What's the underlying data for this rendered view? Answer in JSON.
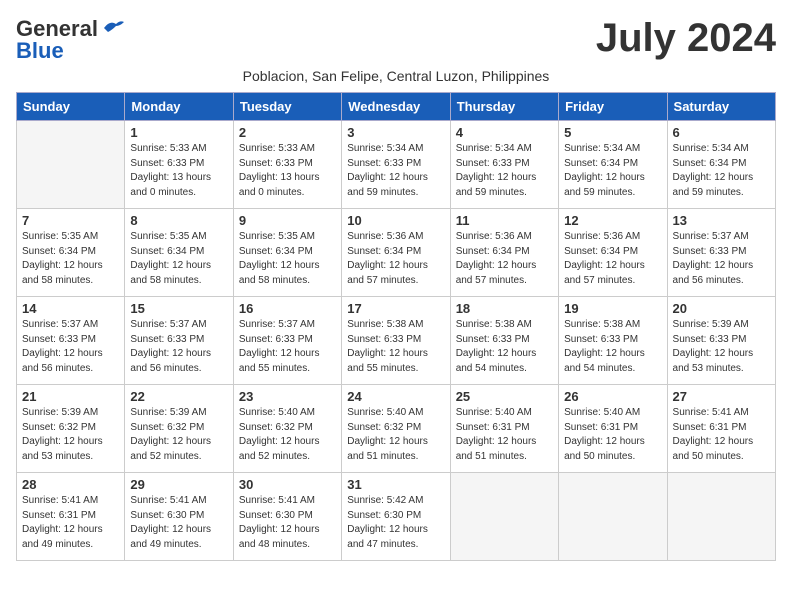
{
  "header": {
    "logo_line1": "General",
    "logo_line2": "Blue",
    "month": "July 2024",
    "subtitle": "Poblacion, San Felipe, Central Luzon, Philippines"
  },
  "days_of_week": [
    "Sunday",
    "Monday",
    "Tuesday",
    "Wednesday",
    "Thursday",
    "Friday",
    "Saturday"
  ],
  "weeks": [
    [
      {
        "date": "",
        "info": ""
      },
      {
        "date": "1",
        "info": "Sunrise: 5:33 AM\nSunset: 6:33 PM\nDaylight: 13 hours\nand 0 minutes."
      },
      {
        "date": "2",
        "info": "Sunrise: 5:33 AM\nSunset: 6:33 PM\nDaylight: 13 hours\nand 0 minutes."
      },
      {
        "date": "3",
        "info": "Sunrise: 5:34 AM\nSunset: 6:33 PM\nDaylight: 12 hours\nand 59 minutes."
      },
      {
        "date": "4",
        "info": "Sunrise: 5:34 AM\nSunset: 6:33 PM\nDaylight: 12 hours\nand 59 minutes."
      },
      {
        "date": "5",
        "info": "Sunrise: 5:34 AM\nSunset: 6:34 PM\nDaylight: 12 hours\nand 59 minutes."
      },
      {
        "date": "6",
        "info": "Sunrise: 5:34 AM\nSunset: 6:34 PM\nDaylight: 12 hours\nand 59 minutes."
      }
    ],
    [
      {
        "date": "7",
        "info": "Sunrise: 5:35 AM\nSunset: 6:34 PM\nDaylight: 12 hours\nand 58 minutes."
      },
      {
        "date": "8",
        "info": "Sunrise: 5:35 AM\nSunset: 6:34 PM\nDaylight: 12 hours\nand 58 minutes."
      },
      {
        "date": "9",
        "info": "Sunrise: 5:35 AM\nSunset: 6:34 PM\nDaylight: 12 hours\nand 58 minutes."
      },
      {
        "date": "10",
        "info": "Sunrise: 5:36 AM\nSunset: 6:34 PM\nDaylight: 12 hours\nand 57 minutes."
      },
      {
        "date": "11",
        "info": "Sunrise: 5:36 AM\nSunset: 6:34 PM\nDaylight: 12 hours\nand 57 minutes."
      },
      {
        "date": "12",
        "info": "Sunrise: 5:36 AM\nSunset: 6:34 PM\nDaylight: 12 hours\nand 57 minutes."
      },
      {
        "date": "13",
        "info": "Sunrise: 5:37 AM\nSunset: 6:33 PM\nDaylight: 12 hours\nand 56 minutes."
      }
    ],
    [
      {
        "date": "14",
        "info": "Sunrise: 5:37 AM\nSunset: 6:33 PM\nDaylight: 12 hours\nand 56 minutes."
      },
      {
        "date": "15",
        "info": "Sunrise: 5:37 AM\nSunset: 6:33 PM\nDaylight: 12 hours\nand 56 minutes."
      },
      {
        "date": "16",
        "info": "Sunrise: 5:37 AM\nSunset: 6:33 PM\nDaylight: 12 hours\nand 55 minutes."
      },
      {
        "date": "17",
        "info": "Sunrise: 5:38 AM\nSunset: 6:33 PM\nDaylight: 12 hours\nand 55 minutes."
      },
      {
        "date": "18",
        "info": "Sunrise: 5:38 AM\nSunset: 6:33 PM\nDaylight: 12 hours\nand 54 minutes."
      },
      {
        "date": "19",
        "info": "Sunrise: 5:38 AM\nSunset: 6:33 PM\nDaylight: 12 hours\nand 54 minutes."
      },
      {
        "date": "20",
        "info": "Sunrise: 5:39 AM\nSunset: 6:33 PM\nDaylight: 12 hours\nand 53 minutes."
      }
    ],
    [
      {
        "date": "21",
        "info": "Sunrise: 5:39 AM\nSunset: 6:32 PM\nDaylight: 12 hours\nand 53 minutes."
      },
      {
        "date": "22",
        "info": "Sunrise: 5:39 AM\nSunset: 6:32 PM\nDaylight: 12 hours\nand 52 minutes."
      },
      {
        "date": "23",
        "info": "Sunrise: 5:40 AM\nSunset: 6:32 PM\nDaylight: 12 hours\nand 52 minutes."
      },
      {
        "date": "24",
        "info": "Sunrise: 5:40 AM\nSunset: 6:32 PM\nDaylight: 12 hours\nand 51 minutes."
      },
      {
        "date": "25",
        "info": "Sunrise: 5:40 AM\nSunset: 6:31 PM\nDaylight: 12 hours\nand 51 minutes."
      },
      {
        "date": "26",
        "info": "Sunrise: 5:40 AM\nSunset: 6:31 PM\nDaylight: 12 hours\nand 50 minutes."
      },
      {
        "date": "27",
        "info": "Sunrise: 5:41 AM\nSunset: 6:31 PM\nDaylight: 12 hours\nand 50 minutes."
      }
    ],
    [
      {
        "date": "28",
        "info": "Sunrise: 5:41 AM\nSunset: 6:31 PM\nDaylight: 12 hours\nand 49 minutes."
      },
      {
        "date": "29",
        "info": "Sunrise: 5:41 AM\nSunset: 6:30 PM\nDaylight: 12 hours\nand 49 minutes."
      },
      {
        "date": "30",
        "info": "Sunrise: 5:41 AM\nSunset: 6:30 PM\nDaylight: 12 hours\nand 48 minutes."
      },
      {
        "date": "31",
        "info": "Sunrise: 5:42 AM\nSunset: 6:30 PM\nDaylight: 12 hours\nand 47 minutes."
      },
      {
        "date": "",
        "info": ""
      },
      {
        "date": "",
        "info": ""
      },
      {
        "date": "",
        "info": ""
      }
    ]
  ]
}
